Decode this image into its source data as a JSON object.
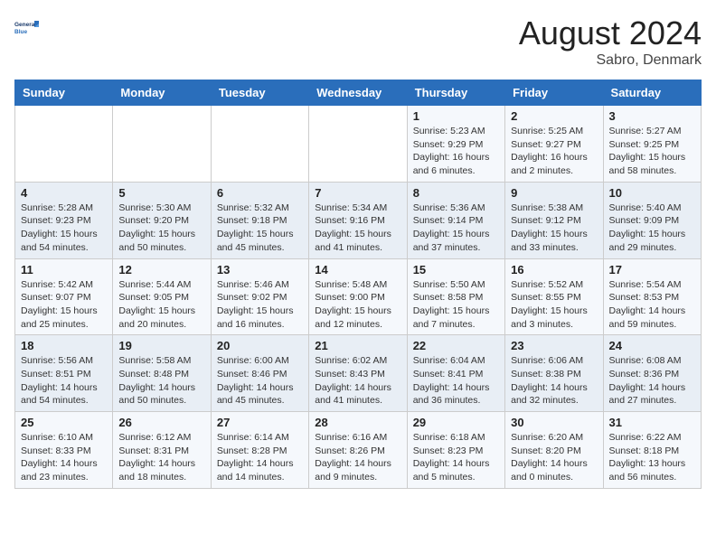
{
  "header": {
    "logo_line1": "General",
    "logo_line2": "Blue",
    "month": "August 2024",
    "location": "Sabro, Denmark"
  },
  "days_of_week": [
    "Sunday",
    "Monday",
    "Tuesday",
    "Wednesday",
    "Thursday",
    "Friday",
    "Saturday"
  ],
  "weeks": [
    [
      {
        "day": "",
        "info": ""
      },
      {
        "day": "",
        "info": ""
      },
      {
        "day": "",
        "info": ""
      },
      {
        "day": "",
        "info": ""
      },
      {
        "day": "1",
        "info": "Sunrise: 5:23 AM\nSunset: 9:29 PM\nDaylight: 16 hours\nand 6 minutes."
      },
      {
        "day": "2",
        "info": "Sunrise: 5:25 AM\nSunset: 9:27 PM\nDaylight: 16 hours\nand 2 minutes."
      },
      {
        "day": "3",
        "info": "Sunrise: 5:27 AM\nSunset: 9:25 PM\nDaylight: 15 hours\nand 58 minutes."
      }
    ],
    [
      {
        "day": "4",
        "info": "Sunrise: 5:28 AM\nSunset: 9:23 PM\nDaylight: 15 hours\nand 54 minutes."
      },
      {
        "day": "5",
        "info": "Sunrise: 5:30 AM\nSunset: 9:20 PM\nDaylight: 15 hours\nand 50 minutes."
      },
      {
        "day": "6",
        "info": "Sunrise: 5:32 AM\nSunset: 9:18 PM\nDaylight: 15 hours\nand 45 minutes."
      },
      {
        "day": "7",
        "info": "Sunrise: 5:34 AM\nSunset: 9:16 PM\nDaylight: 15 hours\nand 41 minutes."
      },
      {
        "day": "8",
        "info": "Sunrise: 5:36 AM\nSunset: 9:14 PM\nDaylight: 15 hours\nand 37 minutes."
      },
      {
        "day": "9",
        "info": "Sunrise: 5:38 AM\nSunset: 9:12 PM\nDaylight: 15 hours\nand 33 minutes."
      },
      {
        "day": "10",
        "info": "Sunrise: 5:40 AM\nSunset: 9:09 PM\nDaylight: 15 hours\nand 29 minutes."
      }
    ],
    [
      {
        "day": "11",
        "info": "Sunrise: 5:42 AM\nSunset: 9:07 PM\nDaylight: 15 hours\nand 25 minutes."
      },
      {
        "day": "12",
        "info": "Sunrise: 5:44 AM\nSunset: 9:05 PM\nDaylight: 15 hours\nand 20 minutes."
      },
      {
        "day": "13",
        "info": "Sunrise: 5:46 AM\nSunset: 9:02 PM\nDaylight: 15 hours\nand 16 minutes."
      },
      {
        "day": "14",
        "info": "Sunrise: 5:48 AM\nSunset: 9:00 PM\nDaylight: 15 hours\nand 12 minutes."
      },
      {
        "day": "15",
        "info": "Sunrise: 5:50 AM\nSunset: 8:58 PM\nDaylight: 15 hours\nand 7 minutes."
      },
      {
        "day": "16",
        "info": "Sunrise: 5:52 AM\nSunset: 8:55 PM\nDaylight: 15 hours\nand 3 minutes."
      },
      {
        "day": "17",
        "info": "Sunrise: 5:54 AM\nSunset: 8:53 PM\nDaylight: 14 hours\nand 59 minutes."
      }
    ],
    [
      {
        "day": "18",
        "info": "Sunrise: 5:56 AM\nSunset: 8:51 PM\nDaylight: 14 hours\nand 54 minutes."
      },
      {
        "day": "19",
        "info": "Sunrise: 5:58 AM\nSunset: 8:48 PM\nDaylight: 14 hours\nand 50 minutes."
      },
      {
        "day": "20",
        "info": "Sunrise: 6:00 AM\nSunset: 8:46 PM\nDaylight: 14 hours\nand 45 minutes."
      },
      {
        "day": "21",
        "info": "Sunrise: 6:02 AM\nSunset: 8:43 PM\nDaylight: 14 hours\nand 41 minutes."
      },
      {
        "day": "22",
        "info": "Sunrise: 6:04 AM\nSunset: 8:41 PM\nDaylight: 14 hours\nand 36 minutes."
      },
      {
        "day": "23",
        "info": "Sunrise: 6:06 AM\nSunset: 8:38 PM\nDaylight: 14 hours\nand 32 minutes."
      },
      {
        "day": "24",
        "info": "Sunrise: 6:08 AM\nSunset: 8:36 PM\nDaylight: 14 hours\nand 27 minutes."
      }
    ],
    [
      {
        "day": "25",
        "info": "Sunrise: 6:10 AM\nSunset: 8:33 PM\nDaylight: 14 hours\nand 23 minutes."
      },
      {
        "day": "26",
        "info": "Sunrise: 6:12 AM\nSunset: 8:31 PM\nDaylight: 14 hours\nand 18 minutes."
      },
      {
        "day": "27",
        "info": "Sunrise: 6:14 AM\nSunset: 8:28 PM\nDaylight: 14 hours\nand 14 minutes."
      },
      {
        "day": "28",
        "info": "Sunrise: 6:16 AM\nSunset: 8:26 PM\nDaylight: 14 hours\nand 9 minutes."
      },
      {
        "day": "29",
        "info": "Sunrise: 6:18 AM\nSunset: 8:23 PM\nDaylight: 14 hours\nand 5 minutes."
      },
      {
        "day": "30",
        "info": "Sunrise: 6:20 AM\nSunset: 8:20 PM\nDaylight: 14 hours\nand 0 minutes."
      },
      {
        "day": "31",
        "info": "Sunrise: 6:22 AM\nSunset: 8:18 PM\nDaylight: 13 hours\nand 56 minutes."
      }
    ]
  ]
}
